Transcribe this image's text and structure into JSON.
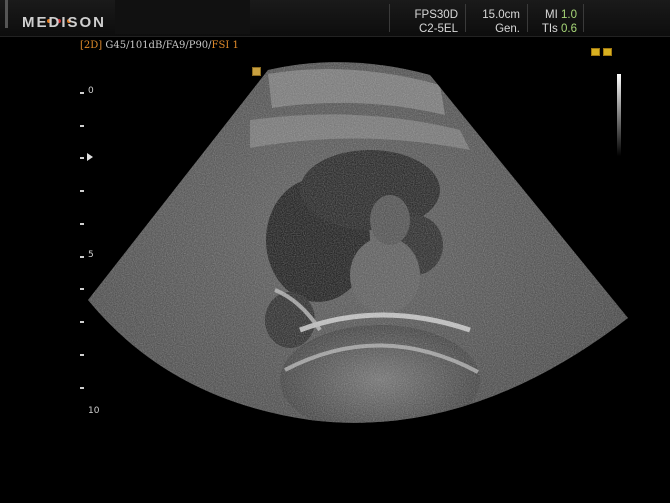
{
  "header": {
    "brand": "MEDISON",
    "probe_preset": "FPS30D",
    "probe_model": "C2-5EL",
    "depth": "15.0cm",
    "frequency": "Gen.",
    "mi_label": "MI",
    "mi_value": "1.0",
    "tis_label": "TIs",
    "tis_value": "0.6"
  },
  "image_params": {
    "mode": "[2D]",
    "gain": "G45",
    "dynamic_range": "101dB",
    "frame_avg": "FA9",
    "power": "P90",
    "fsi": "FSI 1"
  },
  "depth_scale": {
    "top_label": "0",
    "mid_label": "5",
    "bottom_label": "10"
  },
  "colors": {
    "accent_orange": "#e08a2a",
    "value_green": "#a8d878",
    "marker_yellow": "#d8b020"
  }
}
